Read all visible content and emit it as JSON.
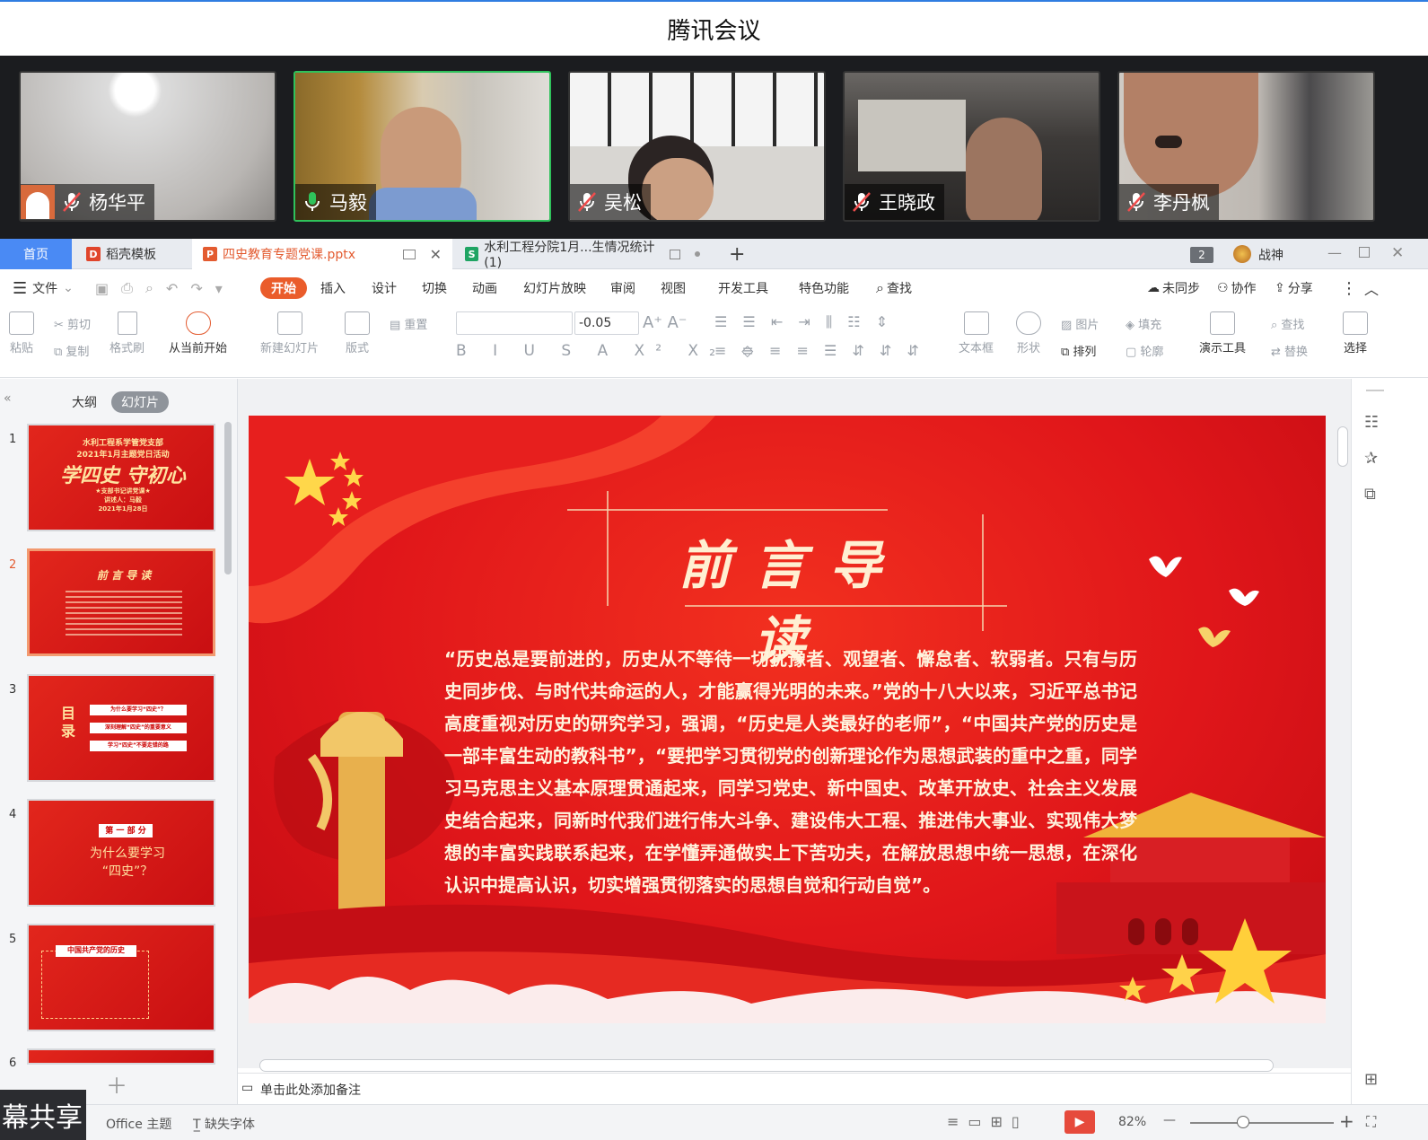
{
  "meeting": {
    "title": "腾讯会议"
  },
  "participants": [
    {
      "name": "杨华平",
      "muted": true
    },
    {
      "name": "马毅",
      "muted": false
    },
    {
      "name": "吴松",
      "muted": true
    },
    {
      "name": "王晓政",
      "muted": true
    },
    {
      "name": "李丹枫",
      "muted": true
    }
  ],
  "tabs": {
    "home": "首页",
    "docer": "稻壳模板",
    "pptx": "四史教育专题党课.pptx",
    "xls": "水利工程分院1月...生情况统计(1)",
    "add": "+",
    "badge": "2",
    "user": "战神"
  },
  "menu": {
    "file": "文件",
    "start": "开始",
    "insert": "插入",
    "design": "设计",
    "transition": "切换",
    "animation": "动画",
    "slideshow": "幻灯片放映",
    "review": "审阅",
    "view": "视图",
    "dev": "开发工具",
    "special": "特色功能",
    "search": "查找",
    "sync": "未同步",
    "collab": "协作",
    "share": "分享"
  },
  "toolbar": {
    "paste": "粘贴",
    "cut": "剪切",
    "copy": "复制",
    "format_painter": "格式刷",
    "from_current": "从当前开始",
    "new_slide": "新建幻灯片",
    "layout": "版式",
    "reset": "重置",
    "font_size": "-0.05",
    "textbox": "文本框",
    "shape": "形状",
    "picture": "图片",
    "fill": "填充",
    "arrange": "排列",
    "outline": "轮廓",
    "present_tools": "演示工具",
    "find": "查找",
    "replace": "替换",
    "select": "选择"
  },
  "panel": {
    "outline": "大纲",
    "slides": "幻灯片"
  },
  "thumbs": [
    {
      "num": "1",
      "title": "学四史 守初心",
      "sub": "水利工程系学管党支部\n2021年1月主题党日活动",
      "note": "★支部书记讲党课★\n讲述人：马毅\n2021年1月28日"
    },
    {
      "num": "2",
      "title": "前 言 导 读"
    },
    {
      "num": "3",
      "title": "目 录",
      "items": [
        "为什么要学习“四史”？",
        "深刻理解“四史”的重要意义",
        "学习“四史”不要走错的路"
      ]
    },
    {
      "num": "4",
      "badge": "第 一 部 分",
      "title": "为什么要学习\n“四史”？"
    },
    {
      "num": "5",
      "title": "中国共产党的历史"
    },
    {
      "num": "6"
    }
  ],
  "slide": {
    "title": "前言导读",
    "body": "“历史总是要前进的，历史从不等待一切犹豫者、观望者、懈怠者、软弱者。只有与历史同步伐、与时代共命运的人，才能赢得光明的未来。”党的十八大以来，习近平总书记高度重视对历史的研究学习，强调，“历史是人类最好的老师”，“中国共产党的历史是一部丰富生动的教科书”，“要把学习贯彻党的创新理论作为思想武装的重中之重，同学习马克思主义基本原理贯通起来，同学习党史、新中国史、改革开放史、社会主义发展史结合起来，同新时代我们进行伟大斗争、建设伟大工程、推进伟大事业、实现伟大梦想的丰富实践联系起来，在学懂弄通做实上下苦功夫，在解放思想中统一思想，在深化认识中提高认识，切实增强贯彻落实的思想自觉和行动自觉”。"
  },
  "notes": {
    "placeholder": "单击此处添加备注"
  },
  "status": {
    "share": "幕共享",
    "theme": "Office 主题",
    "missing_font": "缺失字体",
    "zoom": "82%",
    "plus": "+",
    "minus": "—"
  },
  "colors": {
    "accent": "#4a8af4",
    "start": "#ea5c2b",
    "slide_red": "#e0161a",
    "active_speaker": "#2fc25b"
  }
}
